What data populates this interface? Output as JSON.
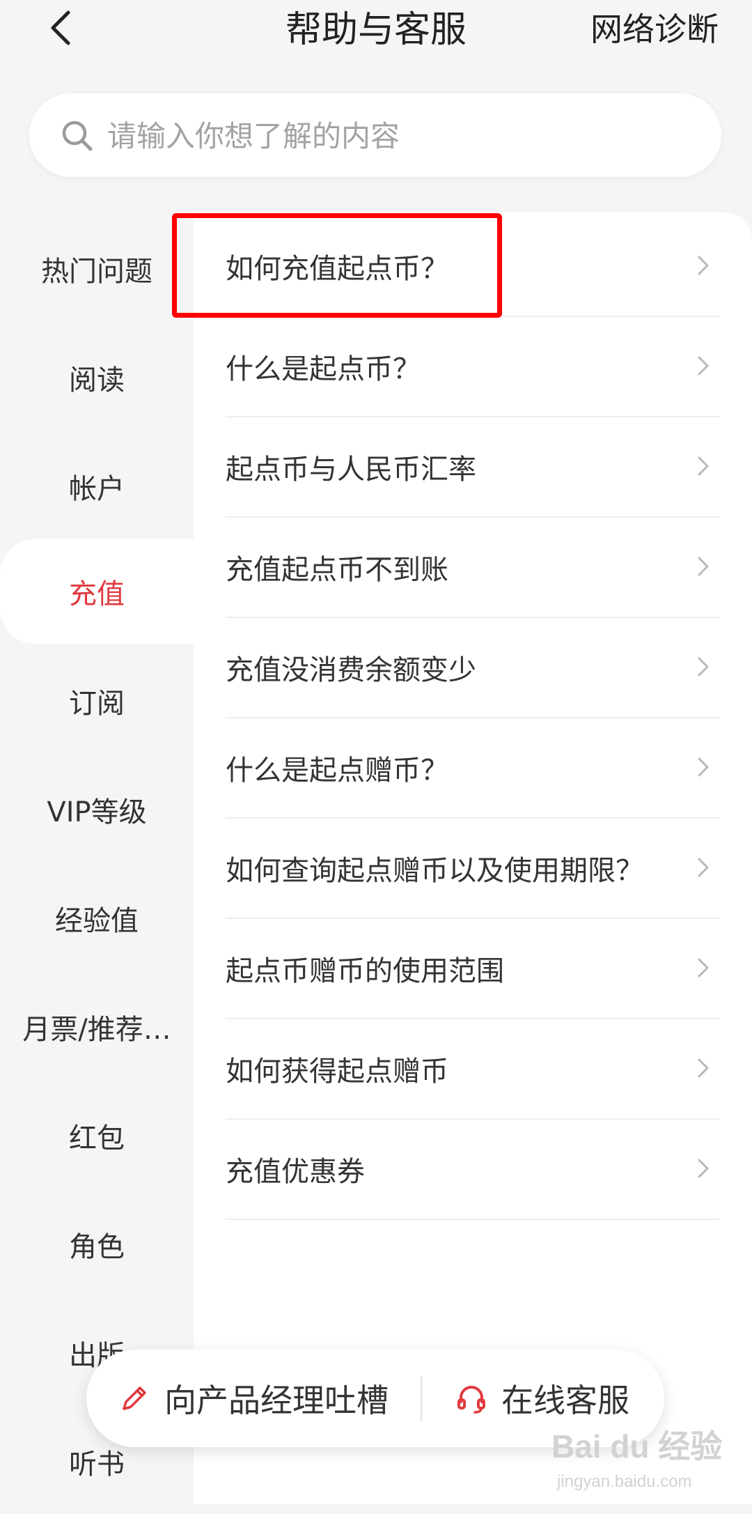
{
  "header": {
    "title": "帮助与客服",
    "network_diag": "网络诊断"
  },
  "search": {
    "placeholder": "请输入你想了解的内容"
  },
  "sidebar": {
    "items": [
      {
        "label": "热门问题"
      },
      {
        "label": "阅读"
      },
      {
        "label": "帐户"
      },
      {
        "label": "充值",
        "active": true
      },
      {
        "label": "订阅"
      },
      {
        "label": "VIP等级"
      },
      {
        "label": "经验值"
      },
      {
        "label": "月票/推荐…"
      },
      {
        "label": "红包"
      },
      {
        "label": "角色"
      },
      {
        "label": "出版"
      },
      {
        "label": "听书"
      }
    ]
  },
  "faq": {
    "items": [
      {
        "label": "如何充值起点币？"
      },
      {
        "label": "什么是起点币？"
      },
      {
        "label": "起点币与人民币汇率"
      },
      {
        "label": "充值起点币不到账"
      },
      {
        "label": "充值没消费余额变少"
      },
      {
        "label": "什么是起点赠币？"
      },
      {
        "label": "如何查询起点赠币以及使用期限？"
      },
      {
        "label": "起点币赠币的使用范围"
      },
      {
        "label": "如何获得起点赠币"
      },
      {
        "label": "充值优惠券"
      }
    ]
  },
  "bottom_bar": {
    "feedback_label": "向产品经理吐槽",
    "service_label": "在线客服"
  },
  "colors": {
    "accent": "#e03a3e",
    "highlight_box": "#ff0000",
    "background": "#f5f5f6"
  },
  "watermark": {
    "brand": "Bai du 经验",
    "domain": "jingyan.baidu.com"
  }
}
